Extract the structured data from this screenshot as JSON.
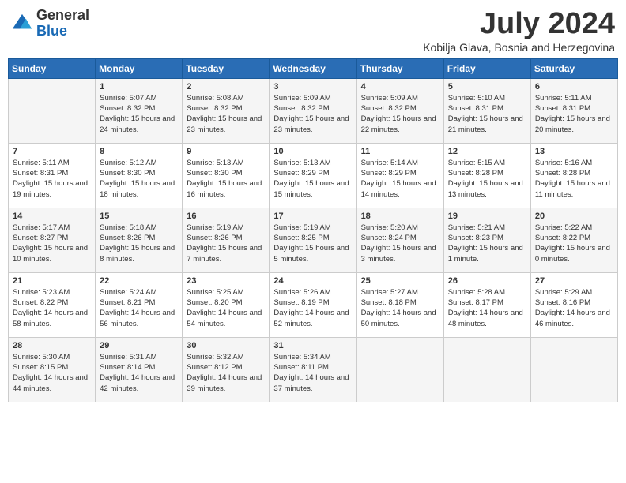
{
  "header": {
    "logo_general": "General",
    "logo_blue": "Blue",
    "month": "July 2024",
    "location": "Kobilja Glava, Bosnia and Herzegovina"
  },
  "weekdays": [
    "Sunday",
    "Monday",
    "Tuesday",
    "Wednesday",
    "Thursday",
    "Friday",
    "Saturday"
  ],
  "weeks": [
    [
      {
        "day": "",
        "sunrise": "",
        "sunset": "",
        "daylight": ""
      },
      {
        "day": "1",
        "sunrise": "Sunrise: 5:07 AM",
        "sunset": "Sunset: 8:32 PM",
        "daylight": "Daylight: 15 hours and 24 minutes."
      },
      {
        "day": "2",
        "sunrise": "Sunrise: 5:08 AM",
        "sunset": "Sunset: 8:32 PM",
        "daylight": "Daylight: 15 hours and 23 minutes."
      },
      {
        "day": "3",
        "sunrise": "Sunrise: 5:09 AM",
        "sunset": "Sunset: 8:32 PM",
        "daylight": "Daylight: 15 hours and 23 minutes."
      },
      {
        "day": "4",
        "sunrise": "Sunrise: 5:09 AM",
        "sunset": "Sunset: 8:32 PM",
        "daylight": "Daylight: 15 hours and 22 minutes."
      },
      {
        "day": "5",
        "sunrise": "Sunrise: 5:10 AM",
        "sunset": "Sunset: 8:31 PM",
        "daylight": "Daylight: 15 hours and 21 minutes."
      },
      {
        "day": "6",
        "sunrise": "Sunrise: 5:11 AM",
        "sunset": "Sunset: 8:31 PM",
        "daylight": "Daylight: 15 hours and 20 minutes."
      }
    ],
    [
      {
        "day": "7",
        "sunrise": "Sunrise: 5:11 AM",
        "sunset": "Sunset: 8:31 PM",
        "daylight": "Daylight: 15 hours and 19 minutes."
      },
      {
        "day": "8",
        "sunrise": "Sunrise: 5:12 AM",
        "sunset": "Sunset: 8:30 PM",
        "daylight": "Daylight: 15 hours and 18 minutes."
      },
      {
        "day": "9",
        "sunrise": "Sunrise: 5:13 AM",
        "sunset": "Sunset: 8:30 PM",
        "daylight": "Daylight: 15 hours and 16 minutes."
      },
      {
        "day": "10",
        "sunrise": "Sunrise: 5:13 AM",
        "sunset": "Sunset: 8:29 PM",
        "daylight": "Daylight: 15 hours and 15 minutes."
      },
      {
        "day": "11",
        "sunrise": "Sunrise: 5:14 AM",
        "sunset": "Sunset: 8:29 PM",
        "daylight": "Daylight: 15 hours and 14 minutes."
      },
      {
        "day": "12",
        "sunrise": "Sunrise: 5:15 AM",
        "sunset": "Sunset: 8:28 PM",
        "daylight": "Daylight: 15 hours and 13 minutes."
      },
      {
        "day": "13",
        "sunrise": "Sunrise: 5:16 AM",
        "sunset": "Sunset: 8:28 PM",
        "daylight": "Daylight: 15 hours and 11 minutes."
      }
    ],
    [
      {
        "day": "14",
        "sunrise": "Sunrise: 5:17 AM",
        "sunset": "Sunset: 8:27 PM",
        "daylight": "Daylight: 15 hours and 10 minutes."
      },
      {
        "day": "15",
        "sunrise": "Sunrise: 5:18 AM",
        "sunset": "Sunset: 8:26 PM",
        "daylight": "Daylight: 15 hours and 8 minutes."
      },
      {
        "day": "16",
        "sunrise": "Sunrise: 5:19 AM",
        "sunset": "Sunset: 8:26 PM",
        "daylight": "Daylight: 15 hours and 7 minutes."
      },
      {
        "day": "17",
        "sunrise": "Sunrise: 5:19 AM",
        "sunset": "Sunset: 8:25 PM",
        "daylight": "Daylight: 15 hours and 5 minutes."
      },
      {
        "day": "18",
        "sunrise": "Sunrise: 5:20 AM",
        "sunset": "Sunset: 8:24 PM",
        "daylight": "Daylight: 15 hours and 3 minutes."
      },
      {
        "day": "19",
        "sunrise": "Sunrise: 5:21 AM",
        "sunset": "Sunset: 8:23 PM",
        "daylight": "Daylight: 15 hours and 1 minute."
      },
      {
        "day": "20",
        "sunrise": "Sunrise: 5:22 AM",
        "sunset": "Sunset: 8:22 PM",
        "daylight": "Daylight: 15 hours and 0 minutes."
      }
    ],
    [
      {
        "day": "21",
        "sunrise": "Sunrise: 5:23 AM",
        "sunset": "Sunset: 8:22 PM",
        "daylight": "Daylight: 14 hours and 58 minutes."
      },
      {
        "day": "22",
        "sunrise": "Sunrise: 5:24 AM",
        "sunset": "Sunset: 8:21 PM",
        "daylight": "Daylight: 14 hours and 56 minutes."
      },
      {
        "day": "23",
        "sunrise": "Sunrise: 5:25 AM",
        "sunset": "Sunset: 8:20 PM",
        "daylight": "Daylight: 14 hours and 54 minutes."
      },
      {
        "day": "24",
        "sunrise": "Sunrise: 5:26 AM",
        "sunset": "Sunset: 8:19 PM",
        "daylight": "Daylight: 14 hours and 52 minutes."
      },
      {
        "day": "25",
        "sunrise": "Sunrise: 5:27 AM",
        "sunset": "Sunset: 8:18 PM",
        "daylight": "Daylight: 14 hours and 50 minutes."
      },
      {
        "day": "26",
        "sunrise": "Sunrise: 5:28 AM",
        "sunset": "Sunset: 8:17 PM",
        "daylight": "Daylight: 14 hours and 48 minutes."
      },
      {
        "day": "27",
        "sunrise": "Sunrise: 5:29 AM",
        "sunset": "Sunset: 8:16 PM",
        "daylight": "Daylight: 14 hours and 46 minutes."
      }
    ],
    [
      {
        "day": "28",
        "sunrise": "Sunrise: 5:30 AM",
        "sunset": "Sunset: 8:15 PM",
        "daylight": "Daylight: 14 hours and 44 minutes."
      },
      {
        "day": "29",
        "sunrise": "Sunrise: 5:31 AM",
        "sunset": "Sunset: 8:14 PM",
        "daylight": "Daylight: 14 hours and 42 minutes."
      },
      {
        "day": "30",
        "sunrise": "Sunrise: 5:32 AM",
        "sunset": "Sunset: 8:12 PM",
        "daylight": "Daylight: 14 hours and 39 minutes."
      },
      {
        "day": "31",
        "sunrise": "Sunrise: 5:34 AM",
        "sunset": "Sunset: 8:11 PM",
        "daylight": "Daylight: 14 hours and 37 minutes."
      },
      {
        "day": "",
        "sunrise": "",
        "sunset": "",
        "daylight": ""
      },
      {
        "day": "",
        "sunrise": "",
        "sunset": "",
        "daylight": ""
      },
      {
        "day": "",
        "sunrise": "",
        "sunset": "",
        "daylight": ""
      }
    ]
  ]
}
